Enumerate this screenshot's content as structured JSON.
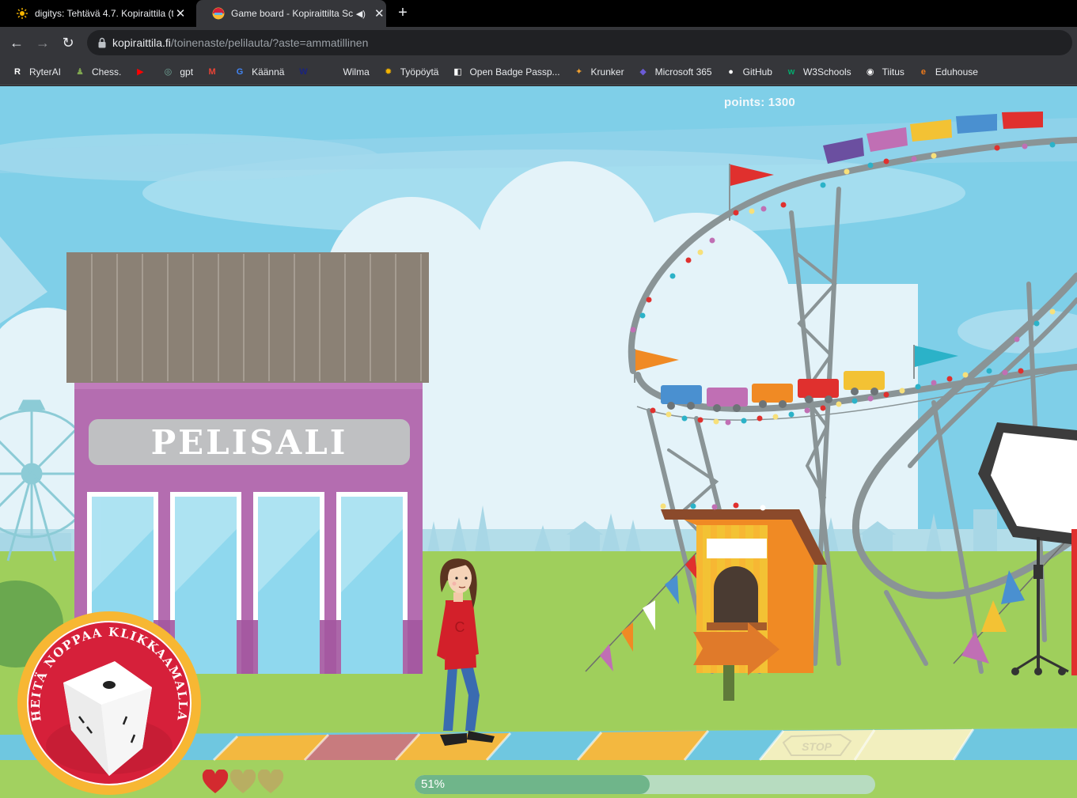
{
  "browser": {
    "tabs": [
      {
        "title": "digitys: Tehtävä 4.7. Kopiraittila (t",
        "icon": "sun-icon",
        "active": false
      },
      {
        "title": "Game board - Kopiraittilta Sc",
        "icon": "kopiraittila-favicon",
        "audio": true,
        "active": true
      }
    ],
    "new_tab_label": "+",
    "url_host": "kopiraittila.fi",
    "url_path": "/toinenaste/pelilauta/?aste=ammatillinen",
    "bookmarks": [
      {
        "label": "RyterAI",
        "icon": "ryterai-icon",
        "color": "#ffffff"
      },
      {
        "label": "Chess.",
        "icon": "chess-icon",
        "color": "#7fa650"
      },
      {
        "label": "",
        "icon": "youtube-icon",
        "color": "#ff0000"
      },
      {
        "label": "gpt",
        "icon": "chatgpt-icon",
        "color": "#74aa9c"
      },
      {
        "label": "",
        "icon": "gmail-icon",
        "color": "#ea4335"
      },
      {
        "label": "Käännä",
        "icon": "translate-icon",
        "color": "#4285f4"
      },
      {
        "label": "",
        "icon": "w-icon",
        "color": "#1a237e"
      },
      {
        "label": "Wilma",
        "icon": "wilma-icon",
        "color": "#ffffff"
      },
      {
        "label": "Työpöytä",
        "icon": "sun-icon",
        "color": "#f5b400"
      },
      {
        "label": "Open Badge Passp...",
        "icon": "badge-icon",
        "color": "#ffffff"
      },
      {
        "label": "Krunker",
        "icon": "krunker-icon",
        "color": "#f0a030"
      },
      {
        "label": "Microsoft 365",
        "icon": "m365-icon",
        "color": "#6b5bd6"
      },
      {
        "label": "GitHub",
        "icon": "github-icon",
        "color": "#ffffff"
      },
      {
        "label": "W3Schools",
        "icon": "w3schools-icon",
        "color": "#04aa6d"
      },
      {
        "label": "Tiitus",
        "icon": "tiitus-icon",
        "color": "#ffffff"
      },
      {
        "label": "Eduhouse",
        "icon": "eduhouse-icon",
        "color": "#f07b1b"
      }
    ]
  },
  "game": {
    "points_text": "points: 1300",
    "building_sign": "PELISALI",
    "dice_button_text": "HEITÄ NOPPAA KLIKKAAMALLA",
    "lives": {
      "total": 3,
      "remaining": 1,
      "full_color": "#d32a2f",
      "empty_color": "#b8ae62"
    },
    "progress": {
      "label": "51%",
      "fraction": 0.51
    },
    "stop_tile_text": "STOP",
    "colors": {
      "sky": "#7fcfe8",
      "grass": "#9fcf5c",
      "building": "#b46db0",
      "roof": "#8b8175",
      "badge_red": "#d6203a",
      "badge_ring": "#f7b733"
    }
  }
}
